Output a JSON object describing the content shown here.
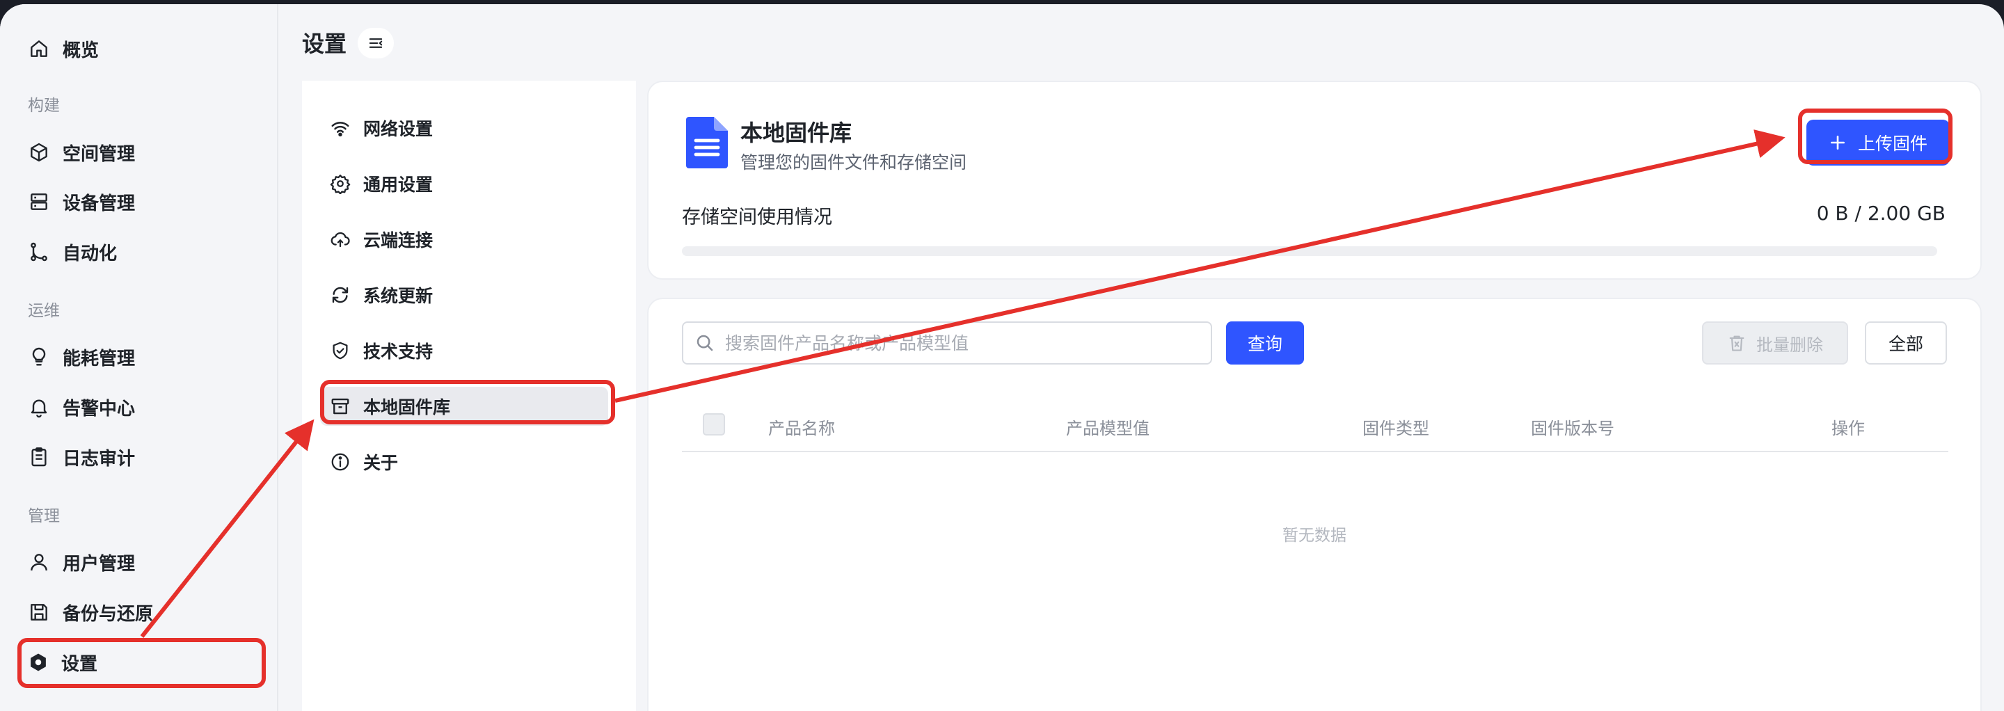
{
  "page": {
    "title": "设置"
  },
  "sidebar": {
    "overview": "概览",
    "groups": {
      "build": "构建",
      "ops": "运维",
      "manage": "管理"
    },
    "items": {
      "space": "空间管理",
      "device": "设备管理",
      "automation": "自动化",
      "energy": "能耗管理",
      "alarm": "告警中心",
      "audit": "日志审计",
      "user": "用户管理",
      "backup": "备份与还原",
      "settings": "设置"
    }
  },
  "settings_menu": {
    "network": "网络设置",
    "general": "通用设置",
    "cloud": "云端连接",
    "update": "系统更新",
    "support": "技术支持",
    "firmware": "本地固件库",
    "about": "关于"
  },
  "storage": {
    "title": "本地固件库",
    "subtitle": "管理您的固件文件和存储空间",
    "usage_label": "存储空间使用情况",
    "usage_value": "0 B / 2.00 GB",
    "used_fraction": 0,
    "upload_label": "上传固件"
  },
  "table": {
    "search_placeholder": "搜索固件产品名称或产品模型值",
    "search_value": "",
    "query_label": "查询",
    "bulk_delete_label": "批量删除",
    "all_label": "全部",
    "columns": [
      "产品名称",
      "产品模型值",
      "固件类型",
      "固件版本号",
      "操作"
    ],
    "empty_text": "暂无数据"
  },
  "colors": {
    "accent": "#2f55ff",
    "annotation": "#e5302b",
    "background": "#f4f5f8"
  }
}
